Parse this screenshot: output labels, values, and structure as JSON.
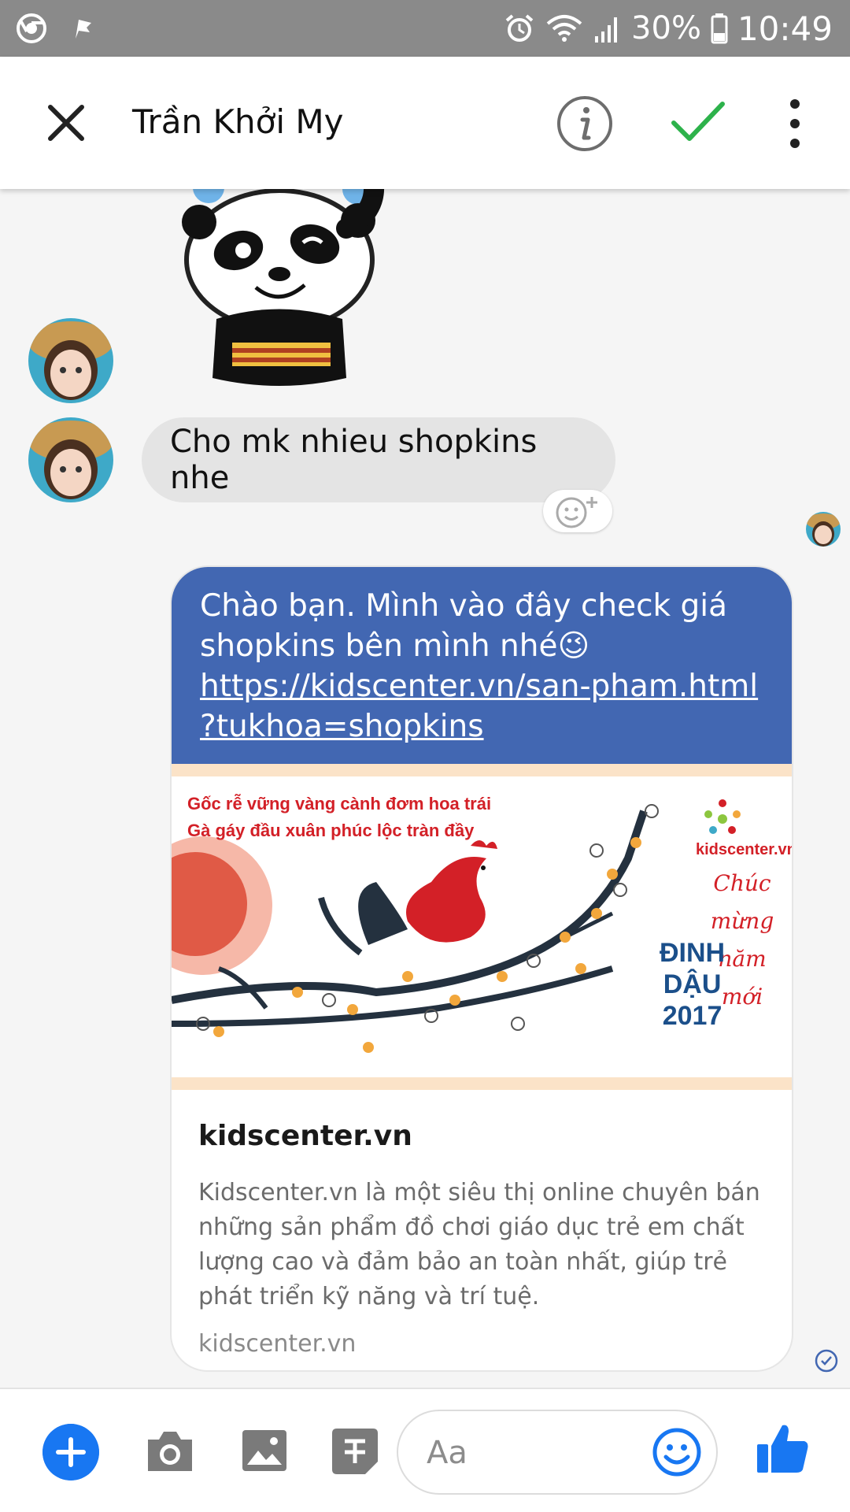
{
  "status_bar": {
    "battery": "30%",
    "time": "10:49"
  },
  "header": {
    "contact_name": "Trần Khởi My"
  },
  "messages": {
    "incoming_text": "Cho mk nhieu shopkins nhe",
    "outgoing_text_line1": "Chào bạn. Mình vào đây check giá",
    "outgoing_text_line2": "shopkins bên mình nhé😉",
    "outgoing_link_line1": "https://kidscenter.vn/san-pham.html",
    "outgoing_link_line2": "?tukhoa=shopkins"
  },
  "link_preview": {
    "banner_line1": "Gốc rễ vững vàng cành đơm hoa trái",
    "banner_line2": "Gà gáy đầu xuân phúc lộc tràn đầy",
    "banner_brand": "kidscenter.vn",
    "banner_greeting1": "Chúc",
    "banner_greeting2": "mừng",
    "banner_greeting3": "năm",
    "banner_greeting4": "mới",
    "banner_year_word1": "ĐINH",
    "banner_year_word2": "DẬU",
    "banner_year": "2017",
    "title": "kidscenter.vn",
    "description": "Kidscenter.vn là một siêu thị online chuyên bán những sản phẩm đồ chơi giáo dục trẻ em chất lượng cao và đảm bảo an toàn nhất, giúp trẻ phát triển kỹ năng và trí tuệ.",
    "domain": "kidscenter.vn"
  },
  "composer": {
    "placeholder": "Aa"
  },
  "colors": {
    "messenger_blue": "#4267b2",
    "accent_blue": "#1877f2",
    "check_green": "#2db24b"
  },
  "icons": {
    "status_left": [
      "chrome-icon",
      "notification-flag-icon"
    ],
    "status_right": [
      "alarm-icon",
      "wifi-icon",
      "signal-icon",
      "battery-icon"
    ],
    "header": [
      "close-icon",
      "info-icon",
      "checkmark-icon",
      "more-vertical-icon"
    ],
    "composer": [
      "plus-icon",
      "camera-icon",
      "image-icon",
      "sticker-icon",
      "emoji-icon",
      "thumbs-up-icon"
    ]
  }
}
